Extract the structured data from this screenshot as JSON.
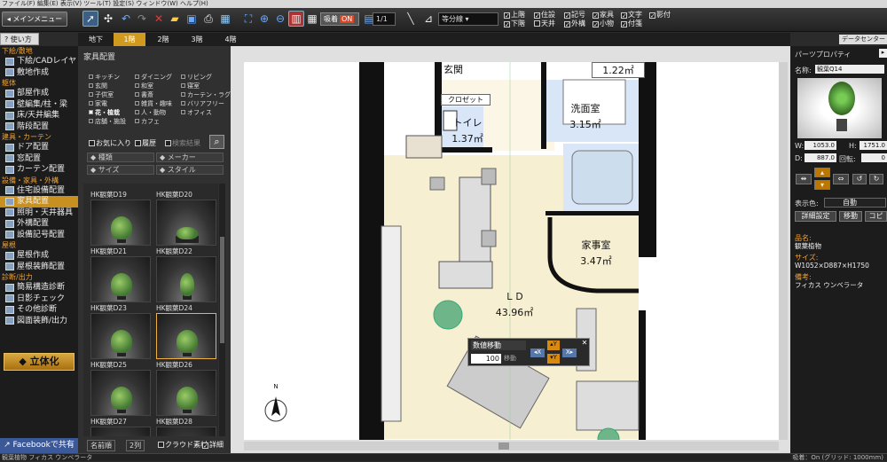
{
  "menubar": {
    "text": "ファイル(F)  編集(E)  表示(V)  ツール(T)  設定(S)  ウィンドウ(W)  ヘルプ(H)"
  },
  "toolbar": {
    "main_menu_label": "メインメニュー",
    "attach_label": "吸着",
    "attach_state": "ON",
    "scale_value": "1/1",
    "contour_value": "等分線",
    "checkboxes": [
      {
        "label": "上階",
        "checked": true
      },
      {
        "label": "下階",
        "checked": true
      },
      {
        "label": "住設",
        "checked": true
      },
      {
        "label": "天井",
        "checked": false
      },
      {
        "label": "記号",
        "checked": true
      },
      {
        "label": "外構",
        "checked": true
      },
      {
        "label": "家具",
        "checked": true
      },
      {
        "label": "小物",
        "checked": true
      },
      {
        "label": "文字",
        "checked": true
      },
      {
        "label": "付箋",
        "checked": true
      },
      {
        "label": "影付",
        "checked": true
      }
    ]
  },
  "help_label": "使い方",
  "floor_tabs": [
    "地下",
    "1階",
    "2階",
    "3階",
    "4階"
  ],
  "selected_floor": "1階",
  "data_center_label": "データセンター",
  "sidebar": {
    "sections": [
      {
        "title": "下絵/敷地",
        "items": [
          "下絵/CADレイヤ",
          "敷地作成"
        ]
      },
      {
        "title": "躯体",
        "items": [
          "部屋作成",
          "壁編集/柱・梁",
          "床/天井編集",
          "階段配置"
        ]
      },
      {
        "title": "建具・カーテン",
        "items": [
          "ドア配置",
          "窓配置",
          "カーテン配置"
        ]
      },
      {
        "title": "設備・家具・外構",
        "items": [
          "住宅設備配置",
          "家具配置",
          "照明・天井器具",
          "外構配置",
          "設備記号配置"
        ]
      },
      {
        "title": "屋根",
        "items": [
          "屋根作成",
          "屋根装飾配置"
        ]
      },
      {
        "title": "診断/出力",
        "items": [
          "簡易構造診断",
          "日影チェック",
          "その他診断",
          "図面装飾/出力"
        ]
      }
    ],
    "selected_item": "家具配置",
    "render_button": "立体化",
    "facebook_button": "Facebookで共有"
  },
  "library": {
    "title": "家具配置",
    "categories": [
      [
        "キッチン",
        "ダイニング",
        "リビング"
      ],
      [
        "玄関",
        "和室",
        "寝室"
      ],
      [
        "子供室",
        "書斎",
        "カーテン・ラグ"
      ],
      [
        "家電",
        "雑貨・趣味",
        "バリアフリー"
      ],
      [
        "花・植栽",
        "人・動物",
        "オフィス"
      ],
      [
        "店舗・施設",
        "カフェ",
        ""
      ]
    ],
    "selected_category": "花・植栽",
    "favorites_label": "お気に入り",
    "history_label": "履歴",
    "search_label": "検索結果",
    "filters": [
      "種類",
      "メーカー",
      "サイズ",
      "スタイル"
    ],
    "items": [
      {
        "name": "HK観葉D19"
      },
      {
        "name": "HK観葉D20"
      },
      {
        "name": "HK観葉D21"
      },
      {
        "name": "HK観葉D22"
      },
      {
        "name": "HK観葉D23"
      },
      {
        "name": "HK観葉D24"
      },
      {
        "name": "HK観葉D25"
      },
      {
        "name": "HK観葉D26"
      },
      {
        "name": "HK観葉D27"
      },
      {
        "name": "HK観葉D28"
      }
    ],
    "selected_item": "HK観葉D24",
    "sort_label": "名前順",
    "columns_label": "2列",
    "cloud_label": "クラウド素材",
    "detail_label": "詳細"
  },
  "rooms": [
    {
      "name": "玄関",
      "area": ""
    },
    {
      "name": "",
      "area": "1.22㎡"
    },
    {
      "name": "クロゼット",
      "area": ""
    },
    {
      "name": "トイレ",
      "area": "1.37㎡"
    },
    {
      "name": "洗面室",
      "area": "3.15㎡"
    },
    {
      "name": "家事室",
      "area": "3.47㎡"
    },
    {
      "name": "ＬＤ",
      "area": "43.96㎡"
    }
  ],
  "numeric_dialog": {
    "title": "数値移動",
    "value": "100",
    "unit": "移動"
  },
  "compass_label": "N",
  "properties": {
    "title": "パーツプロパティ",
    "name_label": "名称:",
    "name_value": "観葉Q14",
    "w_label": "W:",
    "w_value": "1053.0",
    "h_label": "H:",
    "h_value": "1751.0",
    "d_label": "D:",
    "d_value": "887.0",
    "rot_label": "回転:",
    "rot_value": "0",
    "display_color_label": "表示色:",
    "display_color_value": "自動",
    "detail_button": "詳細設定",
    "move_button": "移動",
    "copy_button": "コピー",
    "product_label": "品名:",
    "product_value": "観葉植物",
    "size_label": "サイズ:",
    "size_value": "W1052×D887×H1750",
    "note_label": "備考:",
    "note_value": "フィカス ウンベラータ"
  },
  "statusbar": {
    "left": "観葉植物 フィカス ウンベラータ",
    "right": "吸着：On (グリッド: 1000mm)"
  }
}
